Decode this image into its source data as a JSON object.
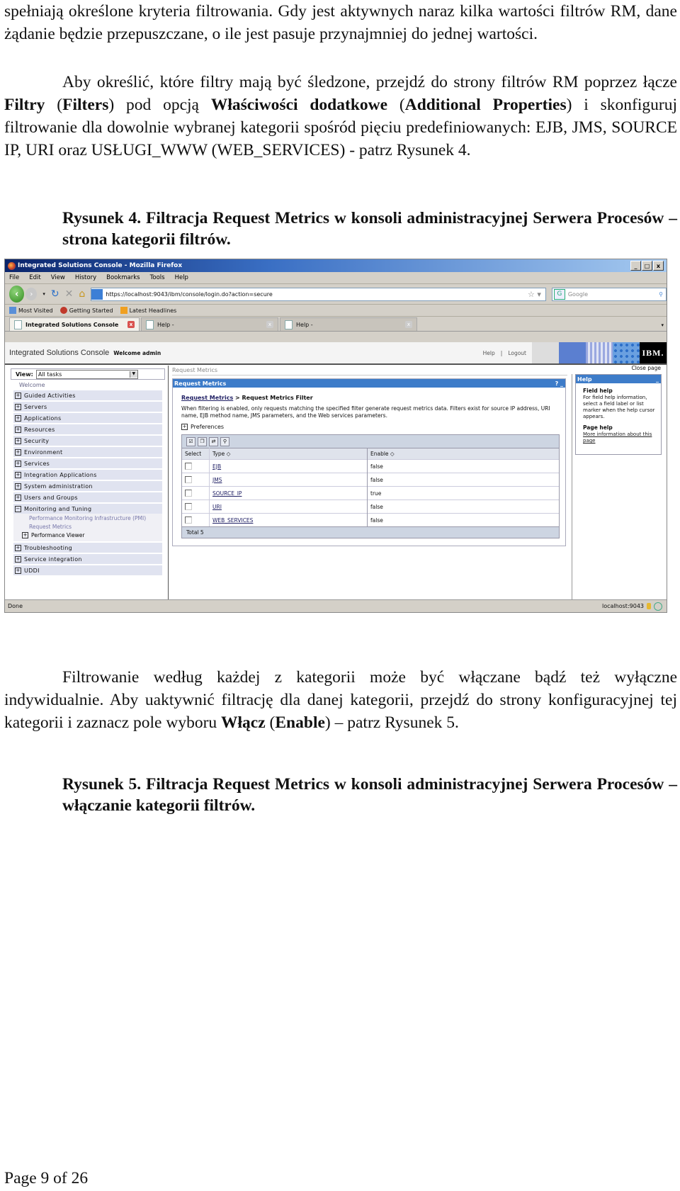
{
  "doc": {
    "para1": "spełniają określone kryteria filtrowania. Gdy jest aktywnych naraz kilka wartości filtrów RM, dane żądanie będzie przepuszczane, o ile jest pasuje przynajmniej do jednej wartości.",
    "para2": {
      "t1": "Aby określić, które filtry mają być śledzone, przejdź do strony filtrów RM poprzez łącze ",
      "b1": "Filtry",
      "t2": " (",
      "b2": "Filters",
      "t3": ") pod opcją ",
      "b3": "Właściwości dodatkowe",
      "t4": " (",
      "b4": "Additional Properties",
      "t5": ") i skonfiguruj filtrowanie dla dowolnie wybranej kategorii spośród pięciu predefiniowanych: EJB, JMS, SOURCE IP, URI oraz USŁUGI_WWW (WEB_SERVICES) - patrz Rysunek 4."
    },
    "caption4": "Rysunek 4. Filtracja Request Metrics w konsoli administracyjnej Serwera Procesów – strona kategorii filtrów.",
    "para3": {
      "t1": "Filtrowanie według każdej z kategorii może być włączane bądź też wyłączne indywidualnie. Aby uaktywnić filtrację dla danej kategorii, przejdź do strony konfiguracyjnej tej kategorii i zaznacz pole wyboru ",
      "b1": "Włącz",
      "t2": " (",
      "b2": "Enable",
      "t3": ") – patrz Rysunek 5."
    },
    "caption5": "Rysunek 5. Filtracja Request Metrics w konsoli administracyjnej Serwera Procesów – włączanie kategorii filtrów.",
    "footer": "Page 9 of 26"
  },
  "browser": {
    "window_title": "Integrated Solutions Console - Mozilla Firefox",
    "menu": [
      "File",
      "Edit",
      "View",
      "History",
      "Bookmarks",
      "Tools",
      "Help"
    ],
    "url": "https://localhost:9043/ibm/console/login.do?action=secure",
    "search_placeholder": "Google",
    "bookmarks": [
      "Most Visited",
      "Getting Started",
      "Latest Headlines"
    ],
    "tabs": [
      "Integrated Solutions Console",
      "Help -",
      "Help -"
    ],
    "status_left": "Done",
    "status_host": "localhost:9043"
  },
  "console": {
    "title": "Integrated Solutions Console",
    "welcome": "Welcome admin",
    "help_link": "Help",
    "logout_link": "Logout",
    "logo": "IBM.",
    "close_page": "Close page",
    "view_label": "View:",
    "view_value": "All tasks",
    "nav_welcome": "Welcome",
    "nav": [
      "Guided Activities",
      "Servers",
      "Applications",
      "Resources",
      "Security",
      "Environment",
      "Services",
      "Integration Applications",
      "System administration",
      "Users and Groups"
    ],
    "nav_expanded": {
      "label": "Monitoring and Tuning",
      "children": [
        "Performance Monitoring Infrastructure (PMI)",
        "Request Metrics"
      ],
      "sub_group": "Performance Viewer"
    },
    "nav_after": [
      "Troubleshooting",
      "Service integration",
      "UDDI"
    ],
    "main": {
      "page_crumb": "Request Metrics",
      "portlet_title": "Request Metrics",
      "breadcrumb_link": "Request Metrics",
      "breadcrumb_sep": " > ",
      "breadcrumb_current": "Request Metrics Filter",
      "description": "When filtering is enabled, only requests matching the specified filter generate request metrics data. Filters exist for source IP address, URI name, EJB method name, JMS parameters, and the Web services parameters.",
      "preferences": "Preferences",
      "columns": [
        "Select",
        "Type ◇",
        "Enable ◇"
      ],
      "rows": [
        {
          "type": "EJB",
          "enable": "false"
        },
        {
          "type": "JMS",
          "enable": "false"
        },
        {
          "type": "SOURCE_IP",
          "enable": "true"
        },
        {
          "type": "URI",
          "enable": "false"
        },
        {
          "type": "WEB_SERVICES",
          "enable": "false"
        }
      ],
      "total": "Total 5"
    },
    "help": {
      "title": "Help",
      "field_help_title": "Field help",
      "field_help_text": "For field help information, select a field label or list marker when the help cursor appears.",
      "page_help_title": "Page help",
      "page_help_link": "More information about this page"
    }
  }
}
